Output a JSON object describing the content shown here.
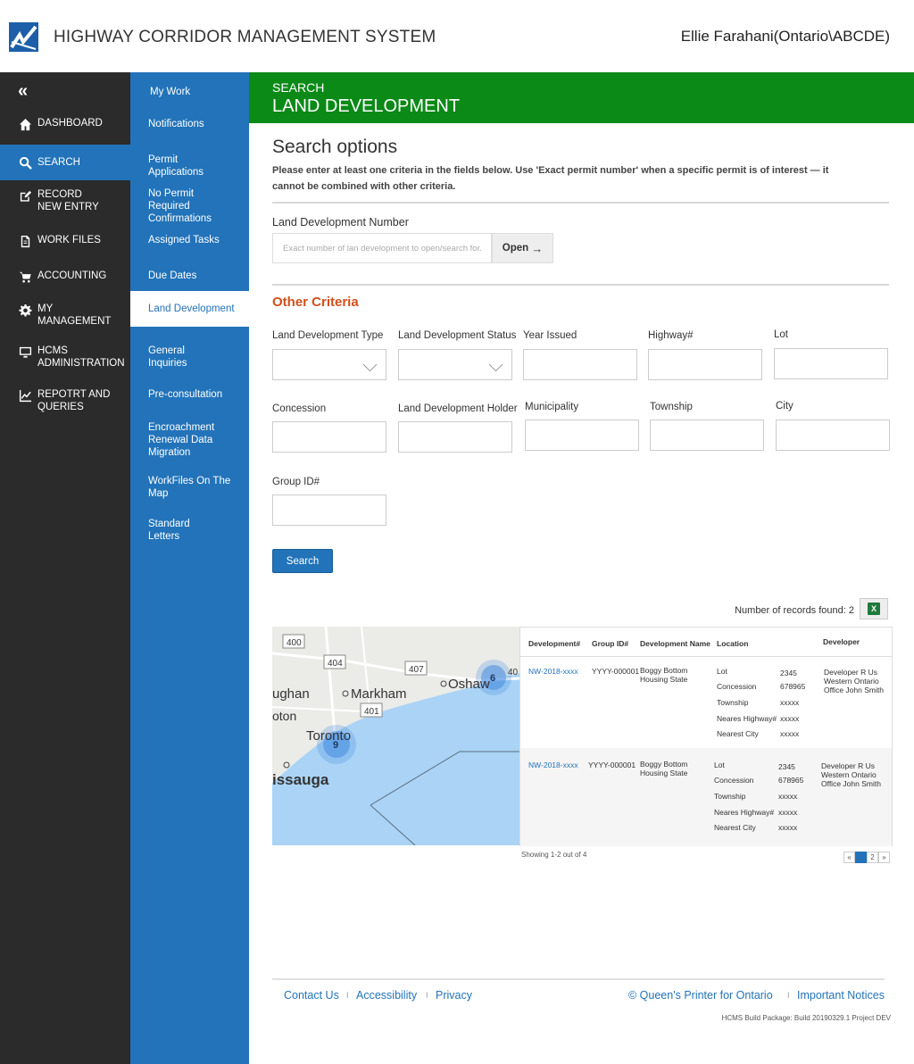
{
  "header": {
    "app_title": "HIGHWAY CORRIDOR MANAGEMENT SYSTEM",
    "user": "Ellie Farahani(Ontario\\ABCDE)"
  },
  "leftnav": {
    "collapse_glyph": "«",
    "items": [
      {
        "label": "DASHBOARD",
        "icon": "home-icon"
      },
      {
        "label": "SEARCH",
        "icon": "search-icon",
        "active": true
      },
      {
        "label": "RECORD NEW ENTRY",
        "icon": "edit-icon"
      },
      {
        "label": "WORK FILES",
        "icon": "file-icon"
      },
      {
        "label": "ACCOUNTING",
        "icon": "cart-icon"
      },
      {
        "label": "MY MANAGEMENT",
        "icon": "gear-icon"
      },
      {
        "label": "HCMS ADMINISTRATION",
        "icon": "monitor-icon"
      },
      {
        "label": "REPOTRT AND QUERIES",
        "icon": "chart-icon"
      }
    ]
  },
  "subnav": {
    "items": [
      {
        "label": "My Work"
      },
      {
        "label": "Notifications"
      },
      {
        "label": "Permit Applications"
      },
      {
        "label": "No Permit Required Confirmations"
      },
      {
        "label": "Assigned Tasks"
      },
      {
        "label": "Due Dates"
      },
      {
        "label": "Land Development",
        "active": true
      },
      {
        "label": "General Inquiries"
      },
      {
        "label": "Pre-consultation"
      },
      {
        "label": "Encroachment Renewal Data Migration"
      },
      {
        "label": "WorkFiles On The Map"
      },
      {
        "label": "Standard Letters"
      }
    ]
  },
  "page": {
    "section": "SEARCH",
    "title": "LAND DEVELOPMENT",
    "search_options": "Search options",
    "description": "Please enter at least one criteria in the fields below. Use 'Exact permit number' when a specific permit is of interest — it cannot be combined with other criteria.",
    "ldn_label": "Land Development Number",
    "ldn_placeholder": "Exact number of lan development  to open/search for.",
    "open_label": "Open",
    "other_criteria": "Other Criteria",
    "fields": {
      "type": "Land Development Type",
      "status": "Land Development Status",
      "year": "Year Issued",
      "highway": "Highway#",
      "lot": "Lot",
      "concession": "Concession",
      "holder": "Land Development Holder",
      "municipality": "Municipality",
      "township": "Township",
      "city": "City",
      "group": "Group ID#"
    },
    "search_button": "Search",
    "records_found": "Number of records found: 2",
    "excel_icon": "excel-icon"
  },
  "map": {
    "labels": [
      "400",
      "404",
      "407",
      "401",
      "ughan",
      "Markham",
      "Oshaw",
      "oton",
      "Toronto",
      "issauga",
      "40"
    ],
    "clusters": [
      {
        "count": "6"
      },
      {
        "count": "9"
      }
    ]
  },
  "results": {
    "columns": [
      "Development#",
      "Group ID#",
      "Development Name",
      "Location",
      "Developer"
    ],
    "rows": [
      {
        "dev": "NW-2018-xxxx",
        "group": "YYYY-000001",
        "name": "Boggy Bottom Housing State",
        "loc_labels": [
          "Lot",
          "Concession",
          "Township",
          "Neares Highway#",
          "Nearest City"
        ],
        "loc_values": [
          "2345",
          "678965",
          "xxxxx",
          "xxxxx",
          "xxxxx"
        ],
        "developer": "Developer R Us Western Ontario Office John Smith"
      },
      {
        "dev": "NW-2018-xxxx",
        "group": "YYYY-000001",
        "name": "Boggy Bottom Housing State",
        "loc_labels": [
          "Lot",
          "Concession",
          "Township",
          "Neares Highway#",
          "Nearest City"
        ],
        "loc_values": [
          "2345",
          "678965",
          "xxxxx",
          "xxxxx",
          "xxxxx"
        ],
        "developer": "Developer R Us Western Ontario Office John Smith"
      }
    ],
    "showing": "Showing 1-2 out of 4",
    "pager": [
      "«",
      "1",
      "2",
      "»"
    ]
  },
  "footer": {
    "contact": "Contact Us",
    "accessibility": "Accessibility",
    "privacy": "Privacy",
    "sep": "I",
    "copyright": "© Queen's Printer for Ontario",
    "notices": "Important Notices",
    "build": "HCMS Build Package: Build 20190329.1 Project DEV"
  },
  "colors": {
    "primary": "#2273b9",
    "green": "#0b8a17",
    "dark_nav": "#2b2b2b",
    "accent": "#d2501a"
  }
}
